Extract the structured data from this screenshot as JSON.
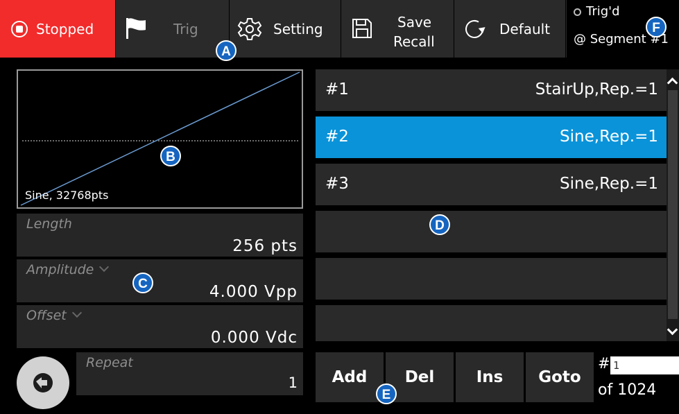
{
  "toolbar": {
    "stopped_label": "Stopped",
    "trig_label": "Trig",
    "setting_label": "Setting",
    "save_label": "Save",
    "recall_label": "Recall",
    "default_label": "Default",
    "status_line1": "Trig'd",
    "status_line2": "@ Segment #1",
    "stopped_color": "#f22b2b",
    "icons": [
      "stop-circle-icon",
      "flag-icon",
      "gear-icon",
      "floppy-disk-icon",
      "refresh-icon"
    ]
  },
  "preview": {
    "label": "Sine, 32768pts",
    "trace_color": "#6b9bd1"
  },
  "params": {
    "length_name": "Length",
    "length_value": "256 pts",
    "amplitude_name": "Amplitude",
    "amplitude_value": "4.000 Vpp",
    "offset_name": "Offset",
    "offset_value": "0.000 Vdc",
    "repeat_name": "Repeat",
    "repeat_value": "1"
  },
  "segments": [
    {
      "num": "#1",
      "desc": "StairUp,Rep.=1",
      "selected": false
    },
    {
      "num": "#2",
      "desc": "Sine,Rep.=1",
      "selected": true
    },
    {
      "num": "#3",
      "desc": "Sine,Rep.=1",
      "selected": false
    },
    {
      "num": "",
      "desc": "",
      "selected": false
    },
    {
      "num": "",
      "desc": "",
      "selected": false
    },
    {
      "num": "",
      "desc": "",
      "selected": false
    }
  ],
  "actions": {
    "add_label": "Add",
    "del_label": "Del",
    "ins_label": "Ins",
    "goto_label": "Goto",
    "hash_label": "#",
    "goto_value": "1",
    "of_label": "of 1024"
  },
  "markers": [
    "A",
    "B",
    "C",
    "D",
    "E",
    "F"
  ],
  "accent_color": "#0a93d9"
}
